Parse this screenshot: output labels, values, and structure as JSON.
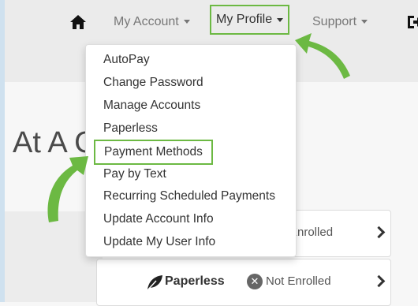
{
  "nav": {
    "home_icon": "home-icon",
    "my_account": "My Account",
    "my_profile": "My Profile",
    "support": "Support",
    "logout_icon": "logout-icon"
  },
  "page": {
    "title": "At A Glance"
  },
  "dropdown": {
    "items": [
      "AutoPay",
      "Change Password",
      "Manage Accounts",
      "Paperless",
      "Payment Methods",
      "Pay by Text",
      "Recurring Scheduled Payments",
      "Update Account Info",
      "Update My User Info"
    ],
    "highlighted_item": "Payment Methods"
  },
  "cards": [
    {
      "label": "",
      "status": "Enrolled"
    },
    {
      "label": "Paperless",
      "status": "Not Enrolled"
    }
  ],
  "colors": {
    "highlight_green": "#6cb943",
    "arrow_green": "#6cb943"
  }
}
